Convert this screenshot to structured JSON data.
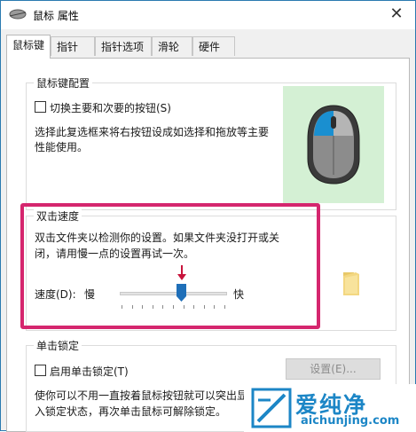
{
  "window": {
    "title": "鼠标 属性",
    "close_glyph": "✕"
  },
  "tabs": [
    {
      "label": "鼠标键",
      "active": true
    },
    {
      "label": "指针"
    },
    {
      "label": "指针选项"
    },
    {
      "label": "滑轮"
    },
    {
      "label": "硬件"
    }
  ],
  "button_config": {
    "label": "鼠标键配置",
    "checkbox_label": "切换主要和次要的按钮(S)",
    "checked": false,
    "description_line1": "选择此复选框来将右按钮设成如选择和拖放等主要",
    "description_line2": "性能使用。"
  },
  "double_click": {
    "label": "双击速度",
    "description_line1": "双击文件夹以检测你的设置。如果文件夹没打开或关",
    "description_line2": "闭，请用慢一点的设置再试一次。",
    "speed_label": "速度(D):",
    "slow_label": "慢",
    "fast_label": "快",
    "speed_value": 0.58,
    "tick_count": 11
  },
  "click_lock": {
    "label": "单击锁定",
    "checkbox_label": "启用单击锁定(T)",
    "checked": false,
    "settings_button": "设置(E)...",
    "description_line1": "使你可以不用一直按着鼠标按钮就可以突出显",
    "description_line2": "入锁定状态，再次单击鼠标可解除锁定。"
  },
  "watermark": {
    "text": "爱纯净",
    "url": "aichunjing.com"
  },
  "colors": {
    "highlight": "#d5266e",
    "mouse_bg": "#d4f0d4",
    "arrow": "#c8143c",
    "thumb": "#1f6fb8",
    "watermark": "#1c86c6"
  }
}
